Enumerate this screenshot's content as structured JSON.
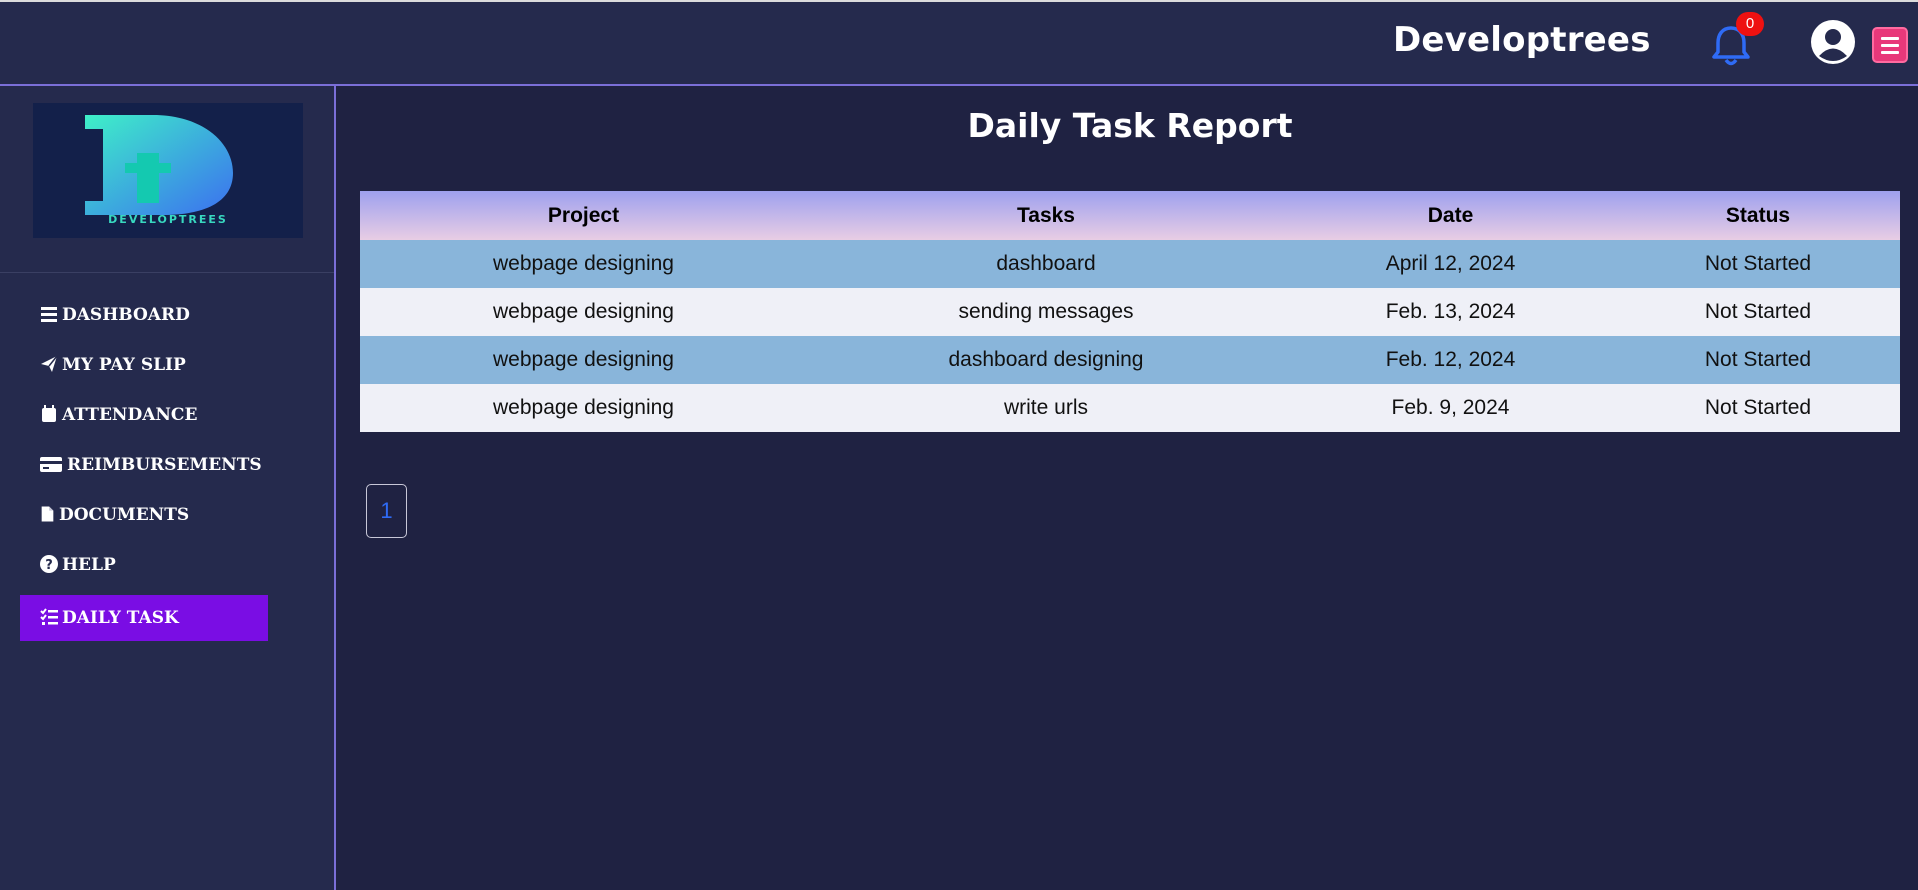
{
  "header": {
    "brand": "Developtrees",
    "notification_count": "0",
    "notification_icon": "bell-icon",
    "user_icon": "user-circle-icon",
    "menu_icon": "hamburger-icon"
  },
  "sidebar": {
    "logo_alt": "DEVELOPTREES",
    "items": [
      {
        "label": "DASHBOARD",
        "icon": "list-icon"
      },
      {
        "label": "MY PAY SLIP",
        "icon": "paper-plane-icon"
      },
      {
        "label": "ATTENDANCE",
        "icon": "calendar-icon"
      },
      {
        "label": "REIMBURSEMENTS",
        "icon": "credit-card-icon"
      },
      {
        "label": "DOCUMENTS",
        "icon": "file-icon"
      },
      {
        "label": "HELP",
        "icon": "question-circle-icon"
      },
      {
        "label": "DAILY TASK",
        "icon": "tasks-icon",
        "active": true
      }
    ]
  },
  "main": {
    "title": "Daily Task Report",
    "table": {
      "headers": [
        "Project",
        "Tasks",
        "Date",
        "Status"
      ],
      "rows": [
        [
          "webpage designing",
          "dashboard",
          "April 12, 2024",
          "Not Started"
        ],
        [
          "webpage designing",
          "sending messages",
          "Feb. 13, 2024",
          "Not Started"
        ],
        [
          "webpage designing",
          "dashboard designing",
          "Feb. 12, 2024",
          "Not Started"
        ],
        [
          "webpage designing",
          "write urls",
          "Feb. 9, 2024",
          "Not Started"
        ]
      ]
    },
    "pagination": {
      "current_page": "1"
    }
  },
  "colors": {
    "background": "#1f2242",
    "panel": "#252a4d",
    "accent_border": "#7b6fd8",
    "active_nav": "#7a0de4",
    "row_blue": "#89b5da",
    "row_light": "#eff0f7",
    "badge": "#ee1111",
    "menu_button": "#e8387a"
  }
}
